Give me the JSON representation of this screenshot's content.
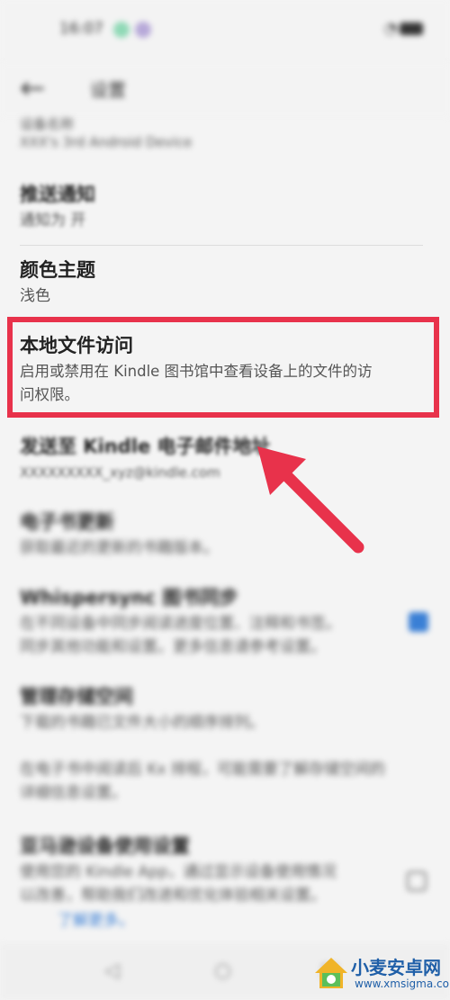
{
  "status_bar": {
    "time": "16:07",
    "dot_colors": [
      "#8fd9b6",
      "#b7a9d9"
    ],
    "icons": [
      "wifi-icon",
      "signal-icon",
      "battery-icon"
    ]
  },
  "app_bar": {
    "title": "设置"
  },
  "top_partial": {
    "title": "设备名称",
    "subtitle": "XXX's 3rd Android Device"
  },
  "rows": [
    {
      "title": "推送通知",
      "subtitle": "通知为 开"
    },
    {
      "title": "颜色主题",
      "subtitle": "浅色"
    },
    {
      "title": "本地文件访问",
      "subtitle_line1": "启用或禁用在 Kindle 图书馆中查看设备上的文件的访",
      "subtitle_line2": "问权限。"
    },
    {
      "title": "发送至 Kindle 电子邮件地址",
      "subtitle": "XXXXXXXXX_xyz@kindle.com"
    },
    {
      "title": "电子书更新",
      "subtitle": "获取最近的更新的书籍版本。"
    },
    {
      "title": "Whispersync 图书同步",
      "subtitle_line1": "在不同设备中同步阅读进度位置、注释和书签。",
      "subtitle_line2": "同步其他功能和设置。更多信息请参考设置。"
    },
    {
      "title": "管理存储空间",
      "subtitle": "下载的书籍已文件大小的顺序排列。"
    },
    {
      "title": "",
      "subtitle_line1": "在电子书中阅读后 Kx 排程，可能需要了解存储空间的",
      "subtitle_line2": "详细信息设置。"
    },
    {
      "title": "亚马逊设备使用设置",
      "subtitle_line1": "使用您的 Kindle App，通过显示设备使用情况",
      "subtitle_line2": "以改善，帮助我们改进和优化体验相关设置。",
      "link": "了解更多。"
    }
  ],
  "nav_bar": {
    "back": "◁",
    "home": "○",
    "recents": "□"
  },
  "watermark": {
    "name": "小麦安卓网",
    "url": "www.xmsigma.com"
  },
  "colors": {
    "highlight": "#e8324b",
    "checkbox_checked": "#3a7fd5",
    "arrow": "#e8324b"
  }
}
